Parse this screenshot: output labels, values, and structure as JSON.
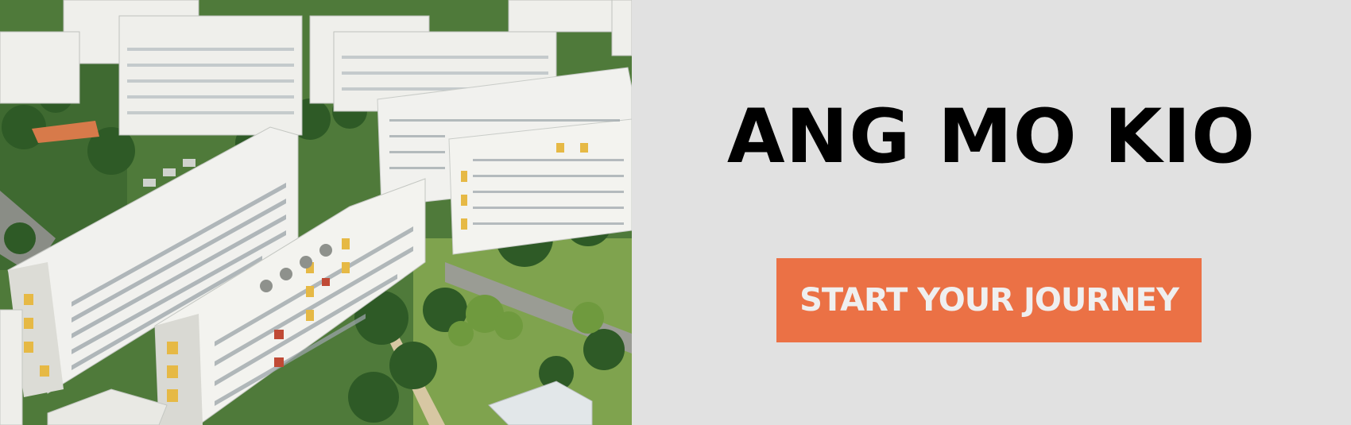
{
  "banner": {
    "title": "ANG MO KIO",
    "cta_label": "START YOUR JOURNEY"
  },
  "photo": {
    "subject": "aerial-housing-estate",
    "palette": {
      "building": "#f1f1ee",
      "building_shade": "#c9ccc8",
      "accent_yellow": "#e6b945",
      "accent_red": "#c04a35",
      "roof_tile": "#d77a4a",
      "tree_dark": "#2e5a26",
      "tree_light": "#6f9a3e",
      "grass": "#7fa34e",
      "road": "#8a8d86"
    }
  },
  "colors": {
    "background": "#e1e1e1",
    "title": "#000000",
    "cta_background": "#eb7145",
    "cta_text": "#efefef"
  }
}
